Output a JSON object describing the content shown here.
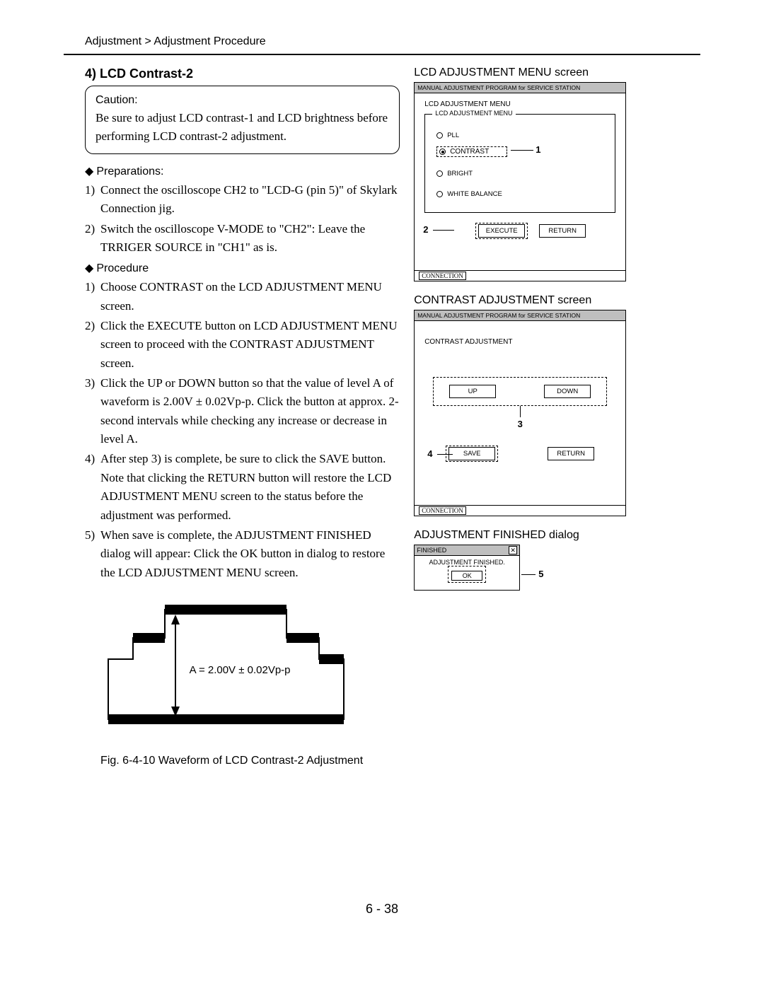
{
  "breadcrumb": "Adjustment > Adjustment Procedure",
  "section_heading": "4)  LCD Contrast-2",
  "caution": {
    "label": "Caution:",
    "text": "Be sure to adjust LCD contrast-1 and LCD brightness before performing LCD contrast-2 adjustment."
  },
  "preparations": {
    "heading": "Preparations:",
    "items": [
      {
        "n": "1)",
        "text": "Connect the oscilloscope CH2 to \"LCD-G (pin 5)\" of Skylark Connection jig."
      },
      {
        "n": "2)",
        "text": "Switch the oscilloscope V-MODE to \"CH2\": Leave the TRRIGER SOURCE in \"CH1\" as is."
      }
    ]
  },
  "procedure": {
    "heading": "Procedure",
    "items": [
      {
        "n": "1)",
        "text": "Choose CONTRAST on the LCD ADJUSTMENT MENU screen."
      },
      {
        "n": "2)",
        "text": "Click the EXECUTE button on LCD ADJUSTMENT MENU screen to proceed with the CONTRAST ADJUSTMENT screen."
      },
      {
        "n": "3)",
        "text": "Click the UP or DOWN button so that the value of level A of waveform is 2.00V ± 0.02Vp-p. Click the button at approx. 2-second intervals while checking any increase or decrease in level A."
      },
      {
        "n": "4)",
        "text": "After step 3) is complete, be sure to click the SAVE button.\nNote that clicking the RETURN button will restore the LCD ADJUSTMENT MENU screen to the status before the adjustment was performed."
      },
      {
        "n": "5)",
        "text": "When save is complete, the ADJUSTMENT FINISHED dialog will appear: Click the OK button in dialog to restore the LCD ADJUSTMENT MENU screen."
      }
    ]
  },
  "waveform": {
    "label": "A = 2.00V ± 0.02Vp-p",
    "caption": "Fig. 6-4-10 Waveform of LCD Contrast-2 Adjustment"
  },
  "screen1": {
    "heading": "LCD ADJUSTMENT MENU screen",
    "titlebar": "MANUAL ADJUSTMENT PROGRAM for SERVICE STATION",
    "menu_title": "LCD ADJUSTMENT MENU",
    "group_legend": "LCD ADJUSTMENT MENU",
    "radios": {
      "pll": "PLL",
      "contrast": "CONTRAST",
      "bright": "BRIGHT",
      "wb": "WHITE BALANCE"
    },
    "buttons": {
      "execute": "EXECUTE",
      "return": "RETURN"
    },
    "status": "CONNECTION",
    "callouts": {
      "c1": "1",
      "c2": "2"
    }
  },
  "screen2": {
    "heading": "CONTRAST ADJUSTMENT screen",
    "titlebar": "MANUAL ADJUSTMENT PROGRAM for SERVICE STATION",
    "title": "CONTRAST ADJUSTMENT",
    "buttons": {
      "up": "UP",
      "down": "DOWN",
      "save": "SAVE",
      "return": "RETURN"
    },
    "status": "CONNECTION",
    "callouts": {
      "c3": "3",
      "c4": "4"
    }
  },
  "dialog": {
    "heading": "ADJUSTMENT FINISHED dialog",
    "title": "FINISHED",
    "body": "ADJUSTMENT FINISHED.",
    "ok": "OK",
    "callout": "5"
  },
  "page_number": "6 - 38"
}
